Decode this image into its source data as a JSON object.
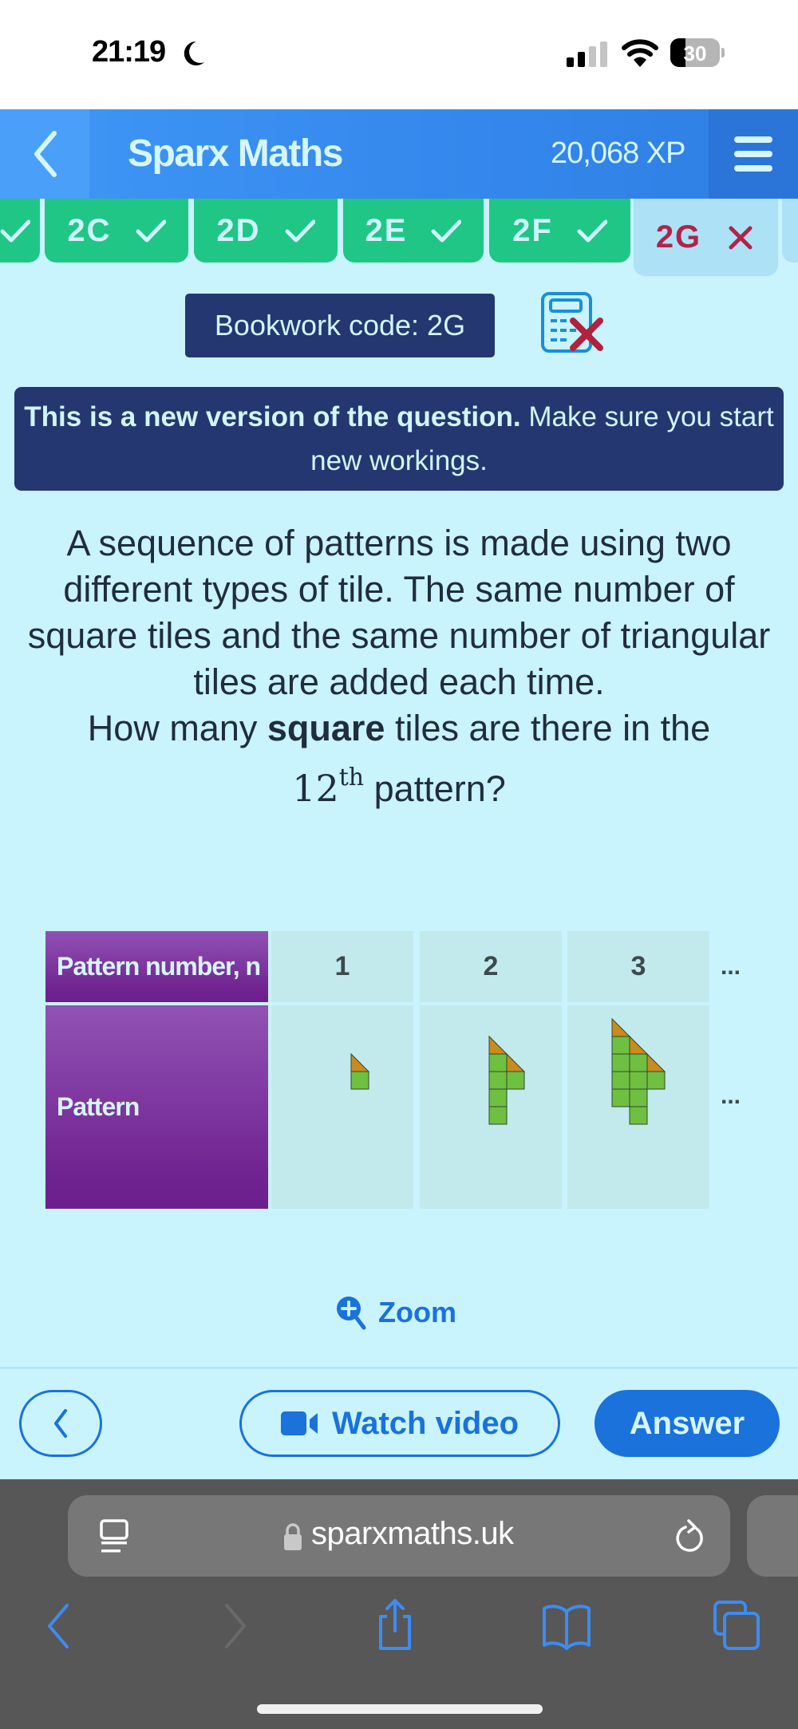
{
  "status_bar": {
    "time": "21:19",
    "battery_percent": 30,
    "battery_label": "30",
    "signal_bars_active": 2,
    "signal_bars_total": 4
  },
  "header": {
    "back_icon": "chevron-left-icon",
    "title": "Sparx Maths",
    "xp": "20,068 XP",
    "menu_icon": "hamburger-menu-icon"
  },
  "tabs": [
    {
      "label": "",
      "status": "complete",
      "partial": true
    },
    {
      "label": "2C",
      "status": "complete"
    },
    {
      "label": "2D",
      "status": "complete"
    },
    {
      "label": "2E",
      "status": "complete"
    },
    {
      "label": "2F",
      "status": "complete"
    },
    {
      "label": "2G",
      "status": "incorrect",
      "current": true
    }
  ],
  "bookwork": {
    "label": "Bookwork code: 2G",
    "calculator_icon": "calculator-not-allowed-icon"
  },
  "notice": {
    "bold": "This is a new version of the question.",
    "rest": " Make sure you start new workings."
  },
  "question": {
    "paragraph": "A sequence of patterns is made using two different types of tile. The same number of square tiles and the same number of triangular tiles are added each time.",
    "ask_before": "How many ",
    "ask_bold": "square",
    "ask_after": " tiles are there in the",
    "ordinal_number": "12",
    "ordinal_suffix": "th",
    "ask_end": " pattern?"
  },
  "pattern_table": {
    "row_header_1": "Pattern number, n",
    "row_header_2": "Pattern",
    "columns": [
      "1",
      "2",
      "3"
    ],
    "ellipsis": "...",
    "patterns": [
      {
        "n": 1,
        "squares": 1,
        "triangles": 1
      },
      {
        "n": 2,
        "squares": 5,
        "triangles": 2
      },
      {
        "n": 3,
        "squares": 9,
        "triangles": 3
      }
    ],
    "colors": {
      "square": "#6fbf41",
      "triangle": "#c98a1e",
      "outline": "#2f4a2c"
    }
  },
  "zoom": {
    "label": "Zoom"
  },
  "buttons": {
    "back_icon": "chevron-left-icon",
    "watch_video": "Watch video",
    "answer": "Answer"
  },
  "browser": {
    "url": "sparxmaths.uk"
  },
  "colors": {
    "page_bg": "#c9f3fd",
    "header_blue": "#3487ec",
    "tab_green": "#20c686",
    "tab_current": "#ade1f6",
    "incorrect_red": "#b0234a",
    "navy": "#243770",
    "accent_blue": "#1a72da",
    "purple": "#6f2290"
  }
}
